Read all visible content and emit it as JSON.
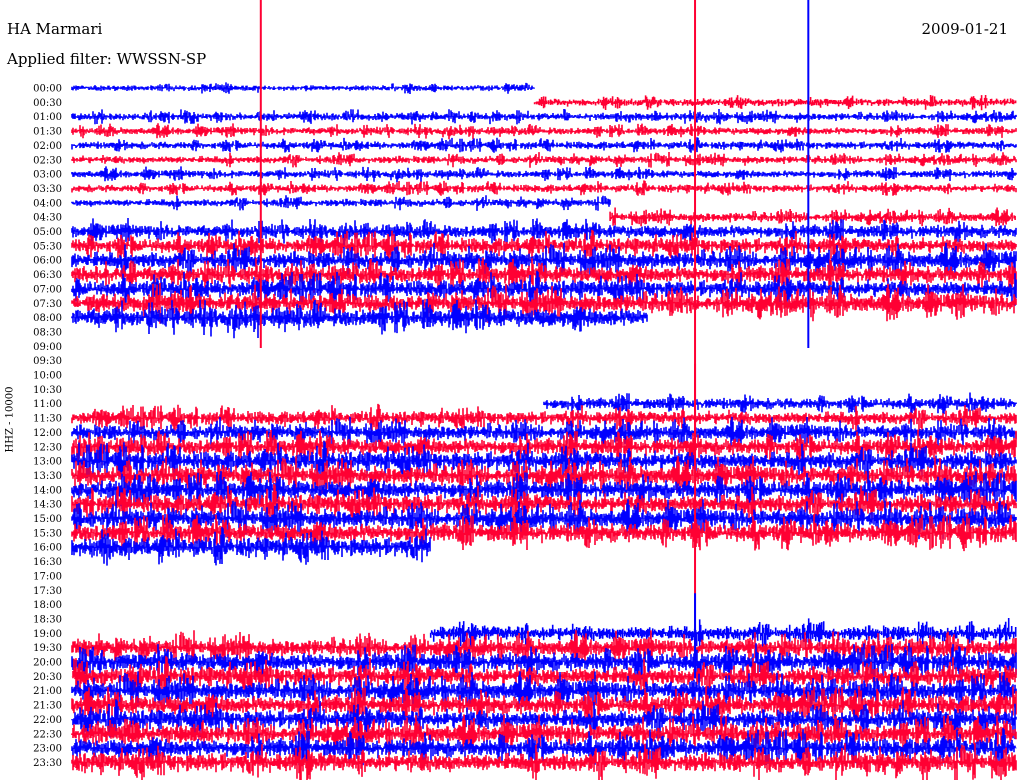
{
  "header": {
    "station": "HA Marmari",
    "date": "2009-01-21",
    "filter": "Applied filter: WWSSN-SP",
    "channel": "HHZ - 10000"
  },
  "colors": {
    "trace_a": "#0000ff",
    "trace_b": "#ff0033",
    "background": "#ffffff"
  },
  "chart_data": {
    "type": "line",
    "title": "HA Marmari",
    "subtitle": "Applied filter: WWSSN-SP",
    "ylabel": "HHZ - 10000",
    "date": "2009-01-21",
    "row_minutes": 30,
    "series_colors": [
      "#0000ff",
      "#ff0033"
    ],
    "rows": [
      {
        "time": "00:00",
        "data": true,
        "x_extent": [
          0,
          0.49
        ],
        "amplitude": 0.3
      },
      {
        "time": "00:30",
        "data": true,
        "x_extent": [
          0.49,
          1
        ],
        "amplitude": 0.4
      },
      {
        "time": "01:00",
        "data": true,
        "x_extent": [
          0,
          1
        ],
        "amplitude": 0.4
      },
      {
        "time": "01:30",
        "data": true,
        "x_extent": [
          0,
          1
        ],
        "amplitude": 0.4
      },
      {
        "time": "02:00",
        "data": true,
        "x_extent": [
          0,
          1
        ],
        "amplitude": 0.4
      },
      {
        "time": "02:30",
        "data": true,
        "x_extent": [
          0,
          1
        ],
        "amplitude": 0.4
      },
      {
        "time": "03:00",
        "data": true,
        "x_extent": [
          0,
          1
        ],
        "amplitude": 0.4
      },
      {
        "time": "03:30",
        "data": true,
        "x_extent": [
          0,
          1
        ],
        "amplitude": 0.4
      },
      {
        "time": "04:00",
        "data": true,
        "x_extent": [
          0,
          0.57
        ],
        "amplitude": 0.4
      },
      {
        "time": "04:30",
        "data": true,
        "x_extent": [
          0.57,
          1
        ],
        "amplitude": 0.5
      },
      {
        "time": "05:00",
        "data": true,
        "x_extent": [
          0,
          1
        ],
        "amplitude": 0.7
      },
      {
        "time": "05:30",
        "data": true,
        "x_extent": [
          0,
          1
        ],
        "amplitude": 0.8
      },
      {
        "time": "06:00",
        "data": true,
        "x_extent": [
          0,
          1
        ],
        "amplitude": 0.9
      },
      {
        "time": "06:30",
        "data": true,
        "x_extent": [
          0,
          1
        ],
        "amplitude": 0.9
      },
      {
        "time": "07:00",
        "data": true,
        "x_extent": [
          0,
          1
        ],
        "amplitude": 0.9
      },
      {
        "time": "07:30",
        "data": true,
        "x_extent": [
          0,
          1
        ],
        "amplitude": 1.0
      },
      {
        "time": "08:00",
        "data": true,
        "x_extent": [
          0,
          0.61
        ],
        "amplitude": 1.0
      },
      {
        "time": "08:30",
        "data": false
      },
      {
        "time": "09:00",
        "data": false
      },
      {
        "time": "09:30",
        "data": false
      },
      {
        "time": "10:00",
        "data": false
      },
      {
        "time": "10:30",
        "data": false
      },
      {
        "time": "11:00",
        "data": true,
        "x_extent": [
          0.5,
          1
        ],
        "amplitude": 0.6
      },
      {
        "time": "11:30",
        "data": true,
        "x_extent": [
          0,
          1
        ],
        "amplitude": 0.7
      },
      {
        "time": "12:00",
        "data": true,
        "x_extent": [
          0,
          1
        ],
        "amplitude": 0.8
      },
      {
        "time": "12:30",
        "data": true,
        "x_extent": [
          0,
          1
        ],
        "amplitude": 0.9
      },
      {
        "time": "13:00",
        "data": true,
        "x_extent": [
          0,
          1
        ],
        "amplitude": 1.0
      },
      {
        "time": "13:30",
        "data": true,
        "x_extent": [
          0,
          1
        ],
        "amplitude": 1.0
      },
      {
        "time": "14:00",
        "data": true,
        "x_extent": [
          0,
          1
        ],
        "amplitude": 1.0
      },
      {
        "time": "14:30",
        "data": true,
        "x_extent": [
          0,
          1
        ],
        "amplitude": 1.0
      },
      {
        "time": "15:00",
        "data": true,
        "x_extent": [
          0,
          1
        ],
        "amplitude": 1.0
      },
      {
        "time": "15:30",
        "data": true,
        "x_extent": [
          0,
          1
        ],
        "amplitude": 1.0
      },
      {
        "time": "16:00",
        "data": true,
        "x_extent": [
          0,
          0.38
        ],
        "amplitude": 1.0
      },
      {
        "time": "16:30",
        "data": false
      },
      {
        "time": "17:00",
        "data": false
      },
      {
        "time": "17:30",
        "data": false
      },
      {
        "time": "18:00",
        "data": false
      },
      {
        "time": "18:30",
        "data": false
      },
      {
        "time": "19:00",
        "data": true,
        "x_extent": [
          0.38,
          1
        ],
        "amplitude": 0.8
      },
      {
        "time": "19:30",
        "data": true,
        "x_extent": [
          0,
          1
        ],
        "amplitude": 0.9
      },
      {
        "time": "20:00",
        "data": true,
        "x_extent": [
          0,
          1
        ],
        "amplitude": 1.0
      },
      {
        "time": "20:30",
        "data": true,
        "x_extent": [
          0,
          1
        ],
        "amplitude": 1.0
      },
      {
        "time": "21:00",
        "data": true,
        "x_extent": [
          0,
          1
        ],
        "amplitude": 1.0
      },
      {
        "time": "21:30",
        "data": true,
        "x_extent": [
          0,
          1
        ],
        "amplitude": 1.0
      },
      {
        "time": "22:00",
        "data": true,
        "x_extent": [
          0,
          1
        ],
        "amplitude": 1.0
      },
      {
        "time": "22:30",
        "data": true,
        "x_extent": [
          0,
          1
        ],
        "amplitude": 1.0
      },
      {
        "time": "23:00",
        "data": true,
        "x_extent": [
          0,
          1
        ],
        "amplitude": 1.0
      },
      {
        "time": "23:30",
        "data": true,
        "x_extent": [
          0,
          1
        ],
        "amplitude": 1.0
      }
    ],
    "spikes": [
      {
        "row": "00:00",
        "x_fraction": 0.2,
        "color": "#ff0033",
        "tall": true
      },
      {
        "row": "00:00",
        "x_fraction": 0.78,
        "color": "#0000ff",
        "tall": true
      },
      {
        "row": "11:30",
        "x_fraction": 0.66,
        "color": "#ff0033",
        "tall": true
      },
      {
        "row": "11:00",
        "x_fraction": 0.66,
        "color": "#ff0033",
        "tall": false
      },
      {
        "row": "19:00",
        "x_fraction": 0.66,
        "color": "#0000ff",
        "tall": false
      }
    ]
  }
}
